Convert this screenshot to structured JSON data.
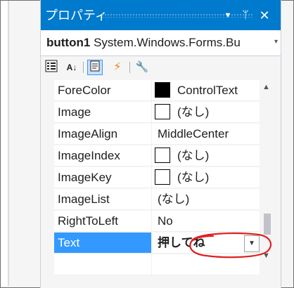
{
  "panel": {
    "title": "プロパティ",
    "object_name": "button1",
    "object_type": "System.Windows.Forms.Bu",
    "title_icons": [
      "chevron-down-icon",
      "pin-icon",
      "close-icon"
    ],
    "toolbar_icons": [
      "categorized-icon",
      "alphabetical-icon",
      "properties-icon",
      "events-icon",
      "property-pages-icon"
    ]
  },
  "properties": [
    {
      "name": "ForeColor",
      "value": "ControlText",
      "swatch": "#000000"
    },
    {
      "name": "Image",
      "value": "(なし)",
      "swatch": "#ffffff"
    },
    {
      "name": "ImageAlign",
      "value": "MiddleCenter"
    },
    {
      "name": "ImageIndex",
      "value": "(なし)",
      "swatch": "#ffffff"
    },
    {
      "name": "ImageKey",
      "value": "(なし)",
      "swatch": "#ffffff"
    },
    {
      "name": "ImageList",
      "value": "(なし)"
    },
    {
      "name": "RightToLeft",
      "value": "No"
    },
    {
      "name": "Text",
      "value": "押してね",
      "selected": true
    }
  ],
  "colors": {
    "accent": "#007acc",
    "selection": "#3399ff",
    "annotation": "#e02020"
  }
}
